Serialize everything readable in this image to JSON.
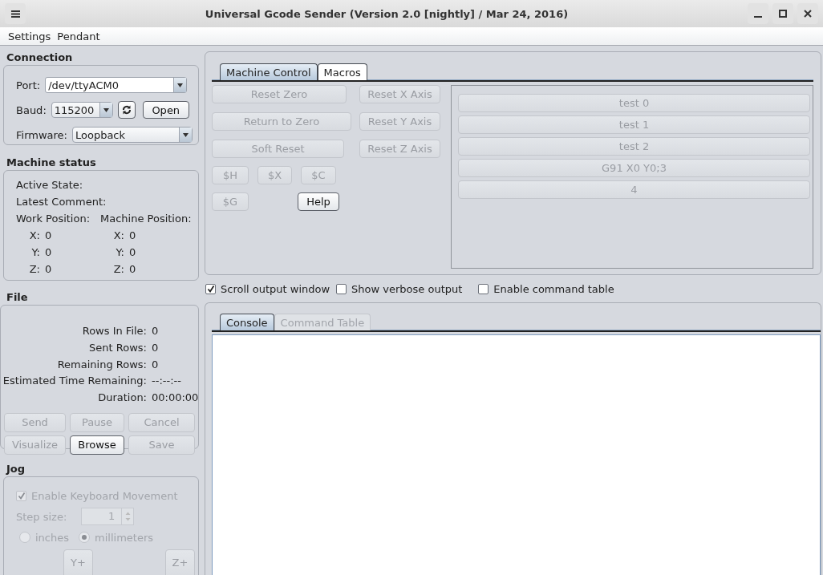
{
  "window": {
    "title": "Universal Gcode Sender (Version 2.0 [nightly]  / Mar 24, 2016)"
  },
  "menu": [
    "Settings",
    "Pendant"
  ],
  "connection": {
    "title": "Connection",
    "port": {
      "label": "Port:",
      "value": "/dev/ttyACM0"
    },
    "baud": {
      "label": "Baud:",
      "value": "115200"
    },
    "open_button": "Open",
    "firmware": {
      "label": "Firmware:",
      "value": "Loopback"
    }
  },
  "machine_status": {
    "title": "Machine status",
    "active_state_label": "Active State:",
    "latest_comment_label": "Latest Comment:",
    "work_position_label": "Work Position:",
    "machine_position_label": "Machine Position:",
    "work_position": [
      {
        "axis": "X:",
        "value": "0"
      },
      {
        "axis": "Y:",
        "value": "0"
      },
      {
        "axis": "Z:",
        "value": "0"
      }
    ],
    "machine_position": [
      {
        "axis": "X:",
        "value": "0"
      },
      {
        "axis": "Y:",
        "value": "0"
      },
      {
        "axis": "Z:",
        "value": "0"
      }
    ]
  },
  "file": {
    "title": "File",
    "stats": [
      {
        "label": "Rows In File:",
        "value": "0"
      },
      {
        "label": "Sent Rows:",
        "value": "0"
      },
      {
        "label": "Remaining Rows:",
        "value": "0"
      },
      {
        "label": "Estimated Time Remaining:",
        "value": "--:--:--"
      },
      {
        "label": "Duration:",
        "value": "00:00:00"
      }
    ],
    "buttons": [
      {
        "label": "Send",
        "disabled": true
      },
      {
        "label": "Pause",
        "disabled": true
      },
      {
        "label": "Cancel",
        "disabled": true
      },
      {
        "label": "Visualize",
        "disabled": true
      },
      {
        "label": "Browse",
        "disabled": false
      },
      {
        "label": "Save",
        "disabled": true
      }
    ]
  },
  "jog": {
    "title": "Jog",
    "keyboard_movement": {
      "label": "Enable Keyboard Movement",
      "checked": true,
      "disabled": true
    },
    "step_size": {
      "label": "Step size:",
      "value": "1"
    },
    "units": [
      {
        "label": "inches",
        "selected": false
      },
      {
        "label": "millimeters",
        "selected": true
      }
    ],
    "buttons": [
      "Y+",
      "Z+"
    ]
  },
  "control_tabs": [
    {
      "label": "Machine Control",
      "selected": true
    },
    {
      "label": "Macros",
      "selected": false
    }
  ],
  "machine_control": {
    "axis_buttons": [
      {
        "label": "Reset Zero",
        "disabled": true
      },
      {
        "label": "Reset X Axis",
        "disabled": true
      },
      {
        "label": "Return to Zero",
        "disabled": true
      },
      {
        "label": "Reset Y Axis",
        "disabled": true
      },
      {
        "label": "Soft Reset",
        "disabled": true
      },
      {
        "label": "Reset Z Axis",
        "disabled": true
      }
    ],
    "command_buttons": [
      {
        "label": "$H",
        "disabled": true
      },
      {
        "label": "$X",
        "disabled": true
      },
      {
        "label": "$C",
        "disabled": true
      },
      {
        "label": "$G",
        "disabled": true
      },
      {
        "label": "Help",
        "disabled": false
      }
    ]
  },
  "macros": [
    {
      "label": "test 0",
      "disabled": true
    },
    {
      "label": "test 1",
      "disabled": true
    },
    {
      "label": "test 2",
      "disabled": true
    },
    {
      "label": "G91 X0 Y0;3",
      "disabled": true
    },
    {
      "label": "4",
      "disabled": true
    }
  ],
  "options": [
    {
      "label": "Scroll output window",
      "checked": true
    },
    {
      "label": "Show verbose output",
      "checked": false
    },
    {
      "label": "Enable command table",
      "checked": false
    }
  ],
  "console_tabs": [
    {
      "label": "Console",
      "selected": true,
      "disabled": false
    },
    {
      "label": "Command Table",
      "selected": false,
      "disabled": true
    }
  ]
}
